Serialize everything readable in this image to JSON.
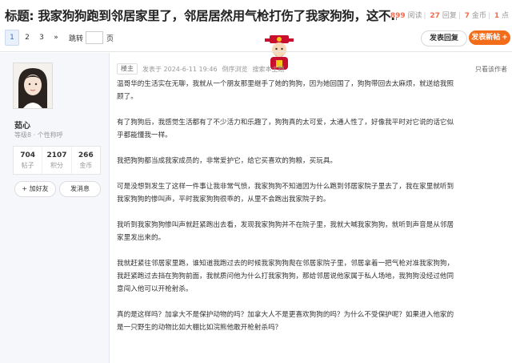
{
  "header": {
    "title_prefix": "标题:",
    "title": "我家狗狗跑到邻居家里了，邻居居然用气枪打伤了我家狗狗，这不...",
    "stats": {
      "views": "899",
      "views_label": "阅读",
      "replies": "27",
      "replies_label": "回复",
      "coins": "7",
      "coins_label": "金币",
      "likes": "1",
      "likes_label": "点"
    },
    "pager": {
      "pages": [
        "1",
        "2",
        "3"
      ],
      "next_glyph": "»",
      "jump_label": "跳转",
      "unit": "页"
    },
    "reply_button": "发表回复",
    "post_button": "发表新帖",
    "post_button_glyph": "+"
  },
  "author": {
    "name": "茹心",
    "rank": "等级8 · 个性称呼",
    "stats": [
      {
        "value": "704",
        "label": "帖子"
      },
      {
        "value": "2107",
        "label": "积分"
      },
      {
        "value": "266",
        "label": "金币"
      }
    ],
    "add_friend": "+ 加好友",
    "message": "发消息"
  },
  "post": {
    "op_badge": "楼主",
    "time": "发表于 2024-6-11 19:46",
    "view_mode": "倒序浏览",
    "search": "搜索本主题",
    "only_author": "只看该作者",
    "paragraphs": [
      "温哥华的生活实在无聊，我就从一个朋友那里继手了她的狗狗，因为她回国了，狗狗带回去太麻烦，就送给我照顾了。",
      "有了狗狗后，我感觉生活都有了不少活力和乐趣了，狗狗真的太可爱，太通人性了，好像我平时对它说的话它似乎都能懂我一样。",
      "我把狗狗都当成我家成员的，非常爱护它，给它买喜欢的狗粮，买玩具。",
      "可是没想到发生了这样一件事让我非常气愤，我家狗狗不知道因为什么跑到邻居家院子里去了，我在家里就听到我家狗狗的惨叫声，平时我家狗狗很乖的，从里不会跑出我家院子的。",
      "我听到我家狗狗惨叫声就赶紧跑出去看，发现我家狗狗并不在院子里，我就大喊我家狗狗，就听到声音是从邻居家里发出来的。",
      "我就赶紧往邻居家里跑，谁知道我跑过去的时候我家狗狗爬在邻居家院子里，邻居拿着一把气枪对准我家狗狗，我赶紧跑过去挡在狗狗前面，我就质问他为什么打我家狗狗，那给邻居说他家属于私人场地，我狗狗没经过他同意闯入他可以开枪射杀。",
      "真的是这样吗？加拿大不是保护动物的吗？加拿大人不是更喜欢狗狗的吗？为什么不受保护呢？如果进入他家的是一只野生的动物比如大棚比如浣熊他敢开枪射杀吗？"
    ]
  }
}
